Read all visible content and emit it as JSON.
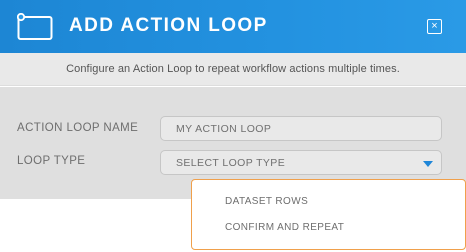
{
  "dialog": {
    "title": "ADD ACTION LOOP",
    "close_symbol": "×",
    "description": "Configure an Action Loop to repeat workflow actions multiple times."
  },
  "form": {
    "name_label": "ACTION LOOP NAME",
    "name_value": "MY ACTION LOOP",
    "type_label": "LOOP TYPE",
    "type_value": "SELECT LOOP TYPE"
  },
  "dropdown": {
    "options": [
      "DATASET ROWS",
      "CONFIRM AND REPEAT"
    ]
  },
  "icons": {
    "header_icon": "loop-window-icon",
    "close_icon": "close-icon",
    "caret_icon": "caret-down-icon"
  },
  "colors": {
    "header_blue": "#2392e0",
    "dropdown_border": "#f0a04b",
    "caret": "#1f86d8"
  }
}
